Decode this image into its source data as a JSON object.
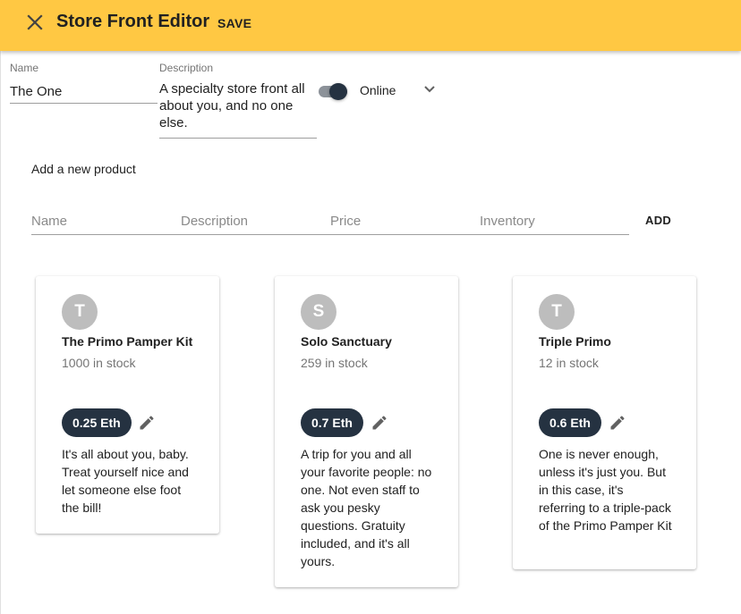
{
  "appbar": {
    "title": "Store Front Editor",
    "save_label": "SAVE",
    "close_icon": "close-icon"
  },
  "store": {
    "name_label": "Name",
    "name_value": "The One",
    "description_label": "Description",
    "description_value": "A specialty store front all about you, and no one else.",
    "online": true,
    "status_value": "Online"
  },
  "new_product": {
    "heading": "Add a new product",
    "name_placeholder": "Name",
    "description_placeholder": "Description",
    "price_placeholder": "Price",
    "inventory_placeholder": "Inventory",
    "add_label": "ADD"
  },
  "products": [
    {
      "initial": "T",
      "name": "The Primo Pamper Kit",
      "stock": "1000 in stock",
      "price": "0.25 Eth",
      "description": "It's all about you, baby. Treat yourself nice and let someone else foot the bill!"
    },
    {
      "initial": "S",
      "name": "Solo Sanctuary",
      "stock": "259 in stock",
      "price": "0.7 Eth",
      "description": "A trip for you and all your favorite people: no one. Not even staff to ask you pesky questions. Gratuity included, and it's all yours."
    },
    {
      "initial": "T",
      "name": "Triple Primo",
      "stock": "12 in stock",
      "price": "0.6 Eth",
      "description": "One is never enough, unless it's just you. But in this case, it's referring to a triple-pack of the Primo Pamper Kit"
    }
  ],
  "colors": {
    "appbar": "#ffc843",
    "chip": "#253241",
    "avatar": "#bdbdbd"
  }
}
